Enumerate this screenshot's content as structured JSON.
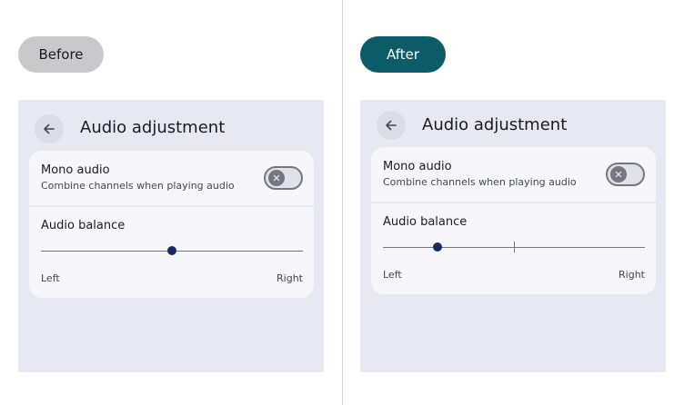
{
  "labels": {
    "before": "Before",
    "after": "After"
  },
  "before": {
    "screen_title": "Audio adjustment",
    "mono": {
      "title": "Mono audio",
      "subtitle": "Combine channels when playing audio",
      "enabled": false
    },
    "balance": {
      "title": "Audio balance",
      "left_label": "Left",
      "right_label": "Right",
      "value": 0.5,
      "center_tick": false
    }
  },
  "after": {
    "screen_title": "Audio adjustment",
    "mono": {
      "title": "Mono audio",
      "subtitle": "Combine channels when playing audio",
      "enabled": false
    },
    "balance": {
      "title": "Audio balance",
      "left_label": "Left",
      "right_label": "Right",
      "value": 0.21,
      "center_tick": true
    }
  },
  "icons": {
    "back": "arrow-left-icon",
    "toggle_off": "close-icon"
  },
  "colors": {
    "after_pill": "#0b5c68",
    "before_pill": "#c9c9cc",
    "slider_thumb": "#1b2a5c",
    "screen_bg": "#e8e8f3"
  }
}
